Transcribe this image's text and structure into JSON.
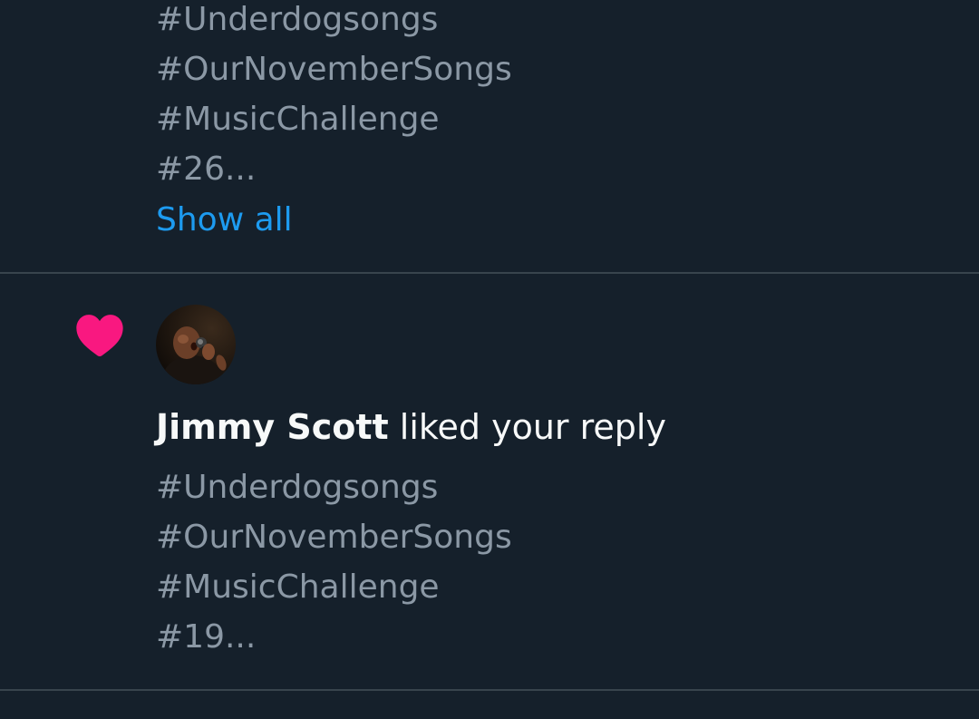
{
  "previous_notification": {
    "hashtags": [
      "#Underdogsongs",
      "#OurNovemberSongs",
      "#MusicChallenge",
      "#26..."
    ],
    "show_all_label": "Show all"
  },
  "like_notification": {
    "icon": "heart-icon",
    "user_name": "Jimmy Scott",
    "action_text": " liked your reply",
    "hashtags": [
      "#Underdogsongs",
      "#OurNovemberSongs",
      "#MusicChallenge",
      "#19..."
    ]
  },
  "colors": {
    "background": "#15202b",
    "heart": "#f91880",
    "link": "#1d9bf0",
    "secondary_text": "#8b98a5",
    "primary_text": "#f7f9f9",
    "divider": "#38444d"
  }
}
